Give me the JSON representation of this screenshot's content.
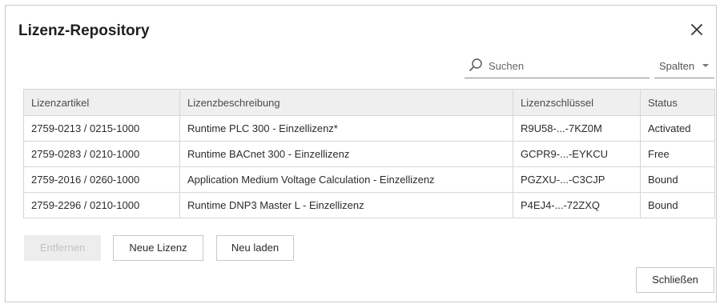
{
  "dialog": {
    "title": "Lizenz-Repository",
    "close_icon": "close-icon"
  },
  "search": {
    "placeholder": "Suchen",
    "value": "",
    "icon": "search-icon"
  },
  "columns_dropdown": {
    "label": "Spalten",
    "icon": "chevron-down-icon"
  },
  "table": {
    "headers": [
      "Lizenzartikel",
      "Lizenzbeschreibung",
      "Lizenzschlüssel",
      "Status"
    ],
    "rows": [
      [
        "2759-0213 / 0215-1000",
        "Runtime PLC 300 - Einzellizenz*",
        "R9U58-...-7KZ0M",
        "Activated"
      ],
      [
        "2759-0283 / 0210-1000",
        "Runtime BACnet 300 - Einzellizenz",
        "GCPR9-...-EYKCU",
        "Free"
      ],
      [
        "2759-2016 / 0260-1000",
        "Application Medium Voltage Calculation - Einzellizenz",
        "PGZXU-...-C3CJP",
        "Bound"
      ],
      [
        "2759-2296 / 0210-1000",
        "Runtime DNP3 Master L - Einzellizenz",
        "P4EJ4-...-72ZXQ",
        "Bound"
      ]
    ]
  },
  "actions": {
    "remove_label": "Entfernen",
    "new_license_label": "Neue Lizenz",
    "reload_label": "Neu laden",
    "close_label": "Schließen"
  },
  "colors": {
    "border": "#c9c9c9",
    "header_bg": "#efefef",
    "disabled_bg": "#ededed",
    "disabled_text": "#c2c2c2"
  }
}
